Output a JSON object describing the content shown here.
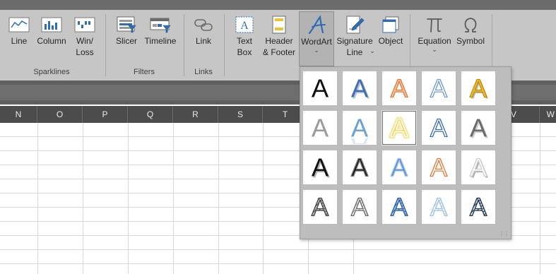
{
  "ribbon": {
    "buttons": {
      "line": {
        "label": "Line"
      },
      "column": {
        "label": "Column"
      },
      "winloss": {
        "label": "Win/\nLoss"
      },
      "slicer": {
        "label": "Slicer"
      },
      "timeline": {
        "label": "Timeline"
      },
      "link": {
        "label": "Link"
      },
      "textbox": {
        "label": "Text\nBox"
      },
      "headerfooter": {
        "label": "Header\n& Footer"
      },
      "wordart": {
        "label": "WordArt"
      },
      "signature": {
        "label": "Signature\nLine"
      },
      "object": {
        "label": "Object"
      },
      "equation": {
        "label": "Equation"
      },
      "symbol": {
        "label": "Symbol"
      }
    },
    "groups": {
      "sparklines": "Sparklines",
      "filters": "Filters",
      "links": "Links"
    }
  },
  "columns": [
    "N",
    "O",
    "P",
    "Q",
    "R",
    "S",
    "T",
    "U",
    "V",
    "W"
  ],
  "wordart_gallery": {
    "selected_index": 7,
    "styles": [
      {
        "id": "fill-black",
        "letter": "A"
      },
      {
        "id": "fill-blue-shadow",
        "letter": "A"
      },
      {
        "id": "fill-orange-outline",
        "letter": "A"
      },
      {
        "id": "fill-white-outline-blue",
        "letter": "A"
      },
      {
        "id": "fill-gold-shadow",
        "letter": "A"
      },
      {
        "id": "fill-gray",
        "letter": "A"
      },
      {
        "id": "fill-blue-reflection",
        "letter": "A"
      },
      {
        "id": "fill-gold-glow",
        "letter": "A"
      },
      {
        "id": "outline-blue",
        "letter": "A"
      },
      {
        "id": "fill-gray-shadow",
        "letter": "A"
      },
      {
        "id": "fill-black-shadow",
        "letter": "A"
      },
      {
        "id": "fill-black-white-outline",
        "letter": "A"
      },
      {
        "id": "fill-blue-bevel",
        "letter": "A"
      },
      {
        "id": "outline-orange",
        "letter": "A"
      },
      {
        "id": "fill-white-gray-shadow",
        "letter": "A"
      },
      {
        "id": "pattern-gray",
        "letter": "A"
      },
      {
        "id": "pattern-gray-light",
        "letter": "A"
      },
      {
        "id": "pattern-blue",
        "letter": "A"
      },
      {
        "id": "pattern-blue-light",
        "letter": "A"
      },
      {
        "id": "pattern-navy",
        "letter": "A"
      }
    ]
  },
  "colors": {
    "ribbon": "#c6c6c6",
    "column_header": "#4c4c4c",
    "accent_blue": "#2e6db4",
    "accent_orange": "#e07b39",
    "accent_gold": "#f2c12e"
  }
}
